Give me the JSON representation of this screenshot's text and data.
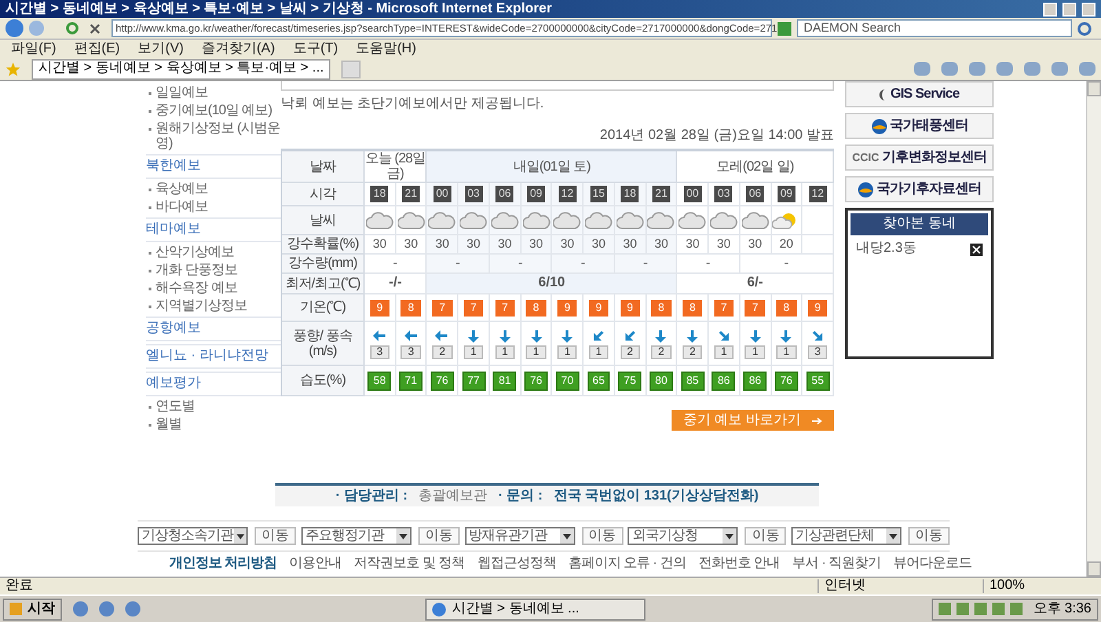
{
  "window": {
    "title": "시간별 > 동네예보 > 육상예보 > 특보·예보 > 날씨 > 기상청 - Microsoft Internet Explorer"
  },
  "address_bar": {
    "url": "http://www.kma.go.kr/weather/forecast/timeseries.jsp?searchType=INTEREST&wideCode=2700000000&cityCode=2717000000&dongCode=271",
    "search": "DAEMON Search"
  },
  "menu": [
    "파일(F)",
    "편집(E)",
    "보기(V)",
    "즐겨찾기(A)",
    "도구(T)",
    "도움말(H)"
  ],
  "tab": {
    "label": "시간별 > 동네예보 > 육상예보 > 특보·예보 > ..."
  },
  "sidebar": {
    "items": [
      {
        "label": "일일예보",
        "kind": "link"
      },
      {
        "label": "중기예보(10일 예보)",
        "kind": "link"
      },
      {
        "label": "원해기상정보 (시범운영)",
        "kind": "link"
      },
      {
        "label": "북한예보",
        "kind": "heading"
      },
      {
        "label": "육상예보",
        "kind": "link"
      },
      {
        "label": "바다예보",
        "kind": "link"
      },
      {
        "label": "테마예보",
        "kind": "heading"
      },
      {
        "label": "산악기상예보",
        "kind": "link"
      },
      {
        "label": "개화 단풍정보",
        "kind": "link"
      },
      {
        "label": "해수욕장 예보",
        "kind": "link"
      },
      {
        "label": "지역별기상정보",
        "kind": "link"
      },
      {
        "label": "공항예보",
        "kind": "heading"
      },
      {
        "label": "엘니뇨 · 라니냐전망",
        "kind": "heading"
      },
      {
        "label": "예보평가",
        "kind": "heading"
      },
      {
        "label": "연도별",
        "kind": "link"
      },
      {
        "label": "월별",
        "kind": "link"
      }
    ]
  },
  "notice": "낙뢰 예보는 초단기예보에서만 제공됩니다.",
  "issued": "2014년 02월 28일 (금)요일 14:00 발표",
  "forecast": {
    "row_labels": {
      "date": "날짜",
      "time": "시각",
      "sky": "날씨",
      "rain_prob": "강수확률(%)",
      "rain_amount": "강수량(mm)",
      "minmax": "최저/최고(℃)",
      "temp": "기온(℃)",
      "wind": "풍향/ 풍속(m/s)",
      "humidity": "습도(%)"
    },
    "days": [
      {
        "label": "오늘 (28일 금)",
        "minmax": "-/-",
        "rain_amounts": [
          "-"
        ],
        "slots": [
          {
            "time": "18",
            "kind": "cloudy",
            "rain_prob": "30",
            "temp": "9",
            "wind": {
              "kind": "west",
              "speed": "3"
            },
            "humidity": "58"
          },
          {
            "time": "21",
            "kind": "cloudy",
            "rain_prob": "30",
            "temp": "8",
            "wind": {
              "kind": "west",
              "speed": "3"
            },
            "humidity": "71"
          }
        ]
      },
      {
        "label": "내일(01일 토)",
        "minmax": "6/10",
        "rain_amounts": [
          "-",
          "-",
          "-",
          "-"
        ],
        "slots": [
          {
            "time": "00",
            "kind": "cloudy",
            "rain_prob": "30",
            "temp": "7",
            "wind": {
              "kind": "west",
              "speed": "2"
            },
            "humidity": "76"
          },
          {
            "time": "03",
            "kind": "cloudy",
            "rain_prob": "30",
            "temp": "7",
            "wind": {
              "kind": "south",
              "speed": "1"
            },
            "humidity": "77"
          },
          {
            "time": "06",
            "kind": "cloudy",
            "rain_prob": "30",
            "temp": "7",
            "wind": {
              "kind": "south",
              "speed": "1"
            },
            "humidity": "81"
          },
          {
            "time": "09",
            "kind": "cloudy",
            "rain_prob": "30",
            "temp": "8",
            "wind": {
              "kind": "south",
              "speed": "1"
            },
            "humidity": "76"
          },
          {
            "time": "12",
            "kind": "cloudy",
            "rain_prob": "30",
            "temp": "9",
            "wind": {
              "kind": "south",
              "speed": "1"
            },
            "humidity": "70"
          },
          {
            "time": "15",
            "kind": "cloudy",
            "rain_prob": "30",
            "temp": "9",
            "wind": {
              "kind": "southwest",
              "speed": "1"
            },
            "humidity": "65"
          },
          {
            "time": "18",
            "kind": "cloudy",
            "rain_prob": "30",
            "temp": "9",
            "wind": {
              "kind": "southwest",
              "speed": "2"
            },
            "humidity": "75"
          },
          {
            "time": "21",
            "kind": "cloudy",
            "rain_prob": "30",
            "temp": "8",
            "wind": {
              "kind": "south",
              "speed": "2"
            },
            "humidity": "80"
          }
        ]
      },
      {
        "label": "모레(02일 일)",
        "minmax": "6/-",
        "rain_amounts": [
          "-",
          "-"
        ],
        "slots": [
          {
            "time": "00",
            "kind": "cloudy",
            "rain_prob": "30",
            "temp": "8",
            "wind": {
              "kind": "south",
              "speed": "2"
            },
            "humidity": "85"
          },
          {
            "time": "03",
            "kind": "cloudy",
            "rain_prob": "30",
            "temp": "7",
            "wind": {
              "kind": "southeast",
              "speed": "1"
            },
            "humidity": "86"
          },
          {
            "time": "06",
            "kind": "cloudy",
            "rain_prob": "30",
            "temp": "7",
            "wind": {
              "kind": "south",
              "speed": "1"
            },
            "humidity": "86"
          },
          {
            "time": "09",
            "kind": "partly_sunny",
            "rain_prob": "20",
            "temp": "8",
            "wind": {
              "kind": "south",
              "speed": "1"
            },
            "humidity": "76"
          },
          {
            "time": "12",
            "kind": "blank",
            "temp": "9",
            "wind": {
              "kind": "southeast",
              "speed": "3"
            },
            "humidity": "55"
          }
        ]
      }
    ]
  },
  "midterm_button": "중기 예보 바로가기",
  "right_links": [
    {
      "label": "GIS Service",
      "kind": "gis"
    },
    {
      "label": "국가태풍센터",
      "kind": "swirl"
    },
    {
      "label": "기후변화정보센터",
      "kind": "ccic",
      "logo": "CCIC"
    },
    {
      "label": "국가기후자료센터",
      "kind": "swirl"
    }
  ],
  "recent": {
    "title": "찾아본 동네",
    "items": [
      "내당2.3동"
    ]
  },
  "contact": {
    "label1": "· 담당관리 :",
    "value1": "총괄예보관",
    "label2": "· 문의 :",
    "value2": "전국 국번없이 131(기상상담전화)"
  },
  "agency_selects": [
    {
      "value": "기상청소속기관",
      "button": "이동"
    },
    {
      "value": "주요행정기관",
      "button": "이동"
    },
    {
      "value": "방재유관기관",
      "button": "이동"
    },
    {
      "value": "외국기상청",
      "button": "이동"
    },
    {
      "value": "기상관련단체",
      "button": "이동"
    }
  ],
  "footer_links": [
    {
      "label": "개인정보 처리방침",
      "selected": true
    },
    {
      "label": "이용안내",
      "selected": false
    },
    {
      "label": "저작권보호 및 정책",
      "selected": false
    },
    {
      "label": "웹접근성정책",
      "selected": false
    },
    {
      "label": "홈페이지 오류 · 건의",
      "selected": false
    },
    {
      "label": "전화번호 안내",
      "selected": false
    },
    {
      "label": "부서 · 직원찾기",
      "selected": false
    },
    {
      "label": "뷰어다운로드",
      "selected": false
    }
  ],
  "status_bar": {
    "status": "완료",
    "zone": "인터넷",
    "zoom": "100%"
  },
  "taskbar": {
    "start": "시작",
    "task": "시간별 > 동네예보 ...",
    "clock": "오후 3:36"
  }
}
